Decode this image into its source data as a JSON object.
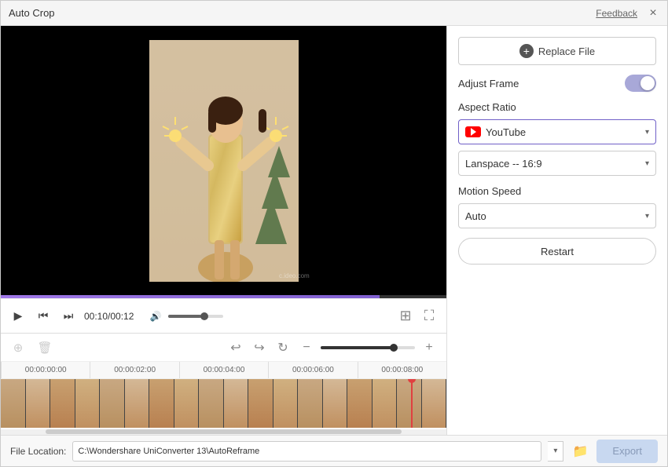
{
  "window": {
    "title": "Auto Crop",
    "feedback": "Feedback",
    "close": "×"
  },
  "rightPanel": {
    "replaceFile": "Replace File",
    "adjustFrame": "Adjust Frame",
    "aspectRatio": "Aspect Ratio",
    "youtubeLabel": "YouTube",
    "landscapeLabel": "Lanspace -- 16:9",
    "motionSpeed": "Motion Speed",
    "motionOption": "Auto",
    "restart": "Restart"
  },
  "controls": {
    "timeDisplay": "00:10/00:12"
  },
  "timeline": {
    "marks": [
      "00:00:00:00",
      "00:00:02:00",
      "00:00:04:00",
      "00:00:06:00",
      "00:00:08:00"
    ]
  },
  "bottomBar": {
    "fileLocationLabel": "File Location:",
    "filePath": "C:\\Wondershare UniConverter 13\\AutoReframe",
    "exportLabel": "Export"
  },
  "icons": {
    "play": "▶",
    "skipBack": "⏮",
    "skipForward": "⏭",
    "volume": "🔊",
    "crop": "⊞",
    "fullscreen": "⛶",
    "undo": "↩",
    "redo": "↪",
    "refresh": "↻",
    "zoomOut": "−",
    "zoomIn": "+",
    "add": "+",
    "delete": "🗑",
    "folder": "📁",
    "dropdownArrow": "▾"
  }
}
